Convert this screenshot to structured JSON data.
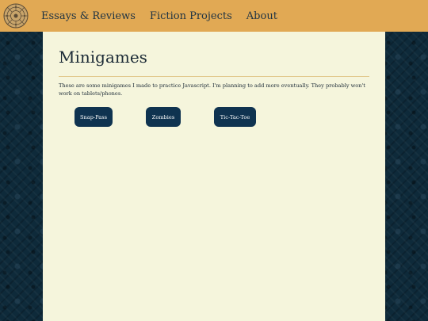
{
  "navbar": {
    "links": [
      {
        "label": "Essays & Reviews"
      },
      {
        "label": "Fiction Projects"
      },
      {
        "label": "About"
      }
    ]
  },
  "main": {
    "title": "Minigames",
    "intro": "These are some minigames I made to practice Javascript. I'm planning to add more eventually. They probably won't work on tablets/phones.",
    "games": [
      {
        "label": "Snap-Pass"
      },
      {
        "label": "Zombies"
      },
      {
        "label": "Tic-Tac-Toe"
      }
    ]
  },
  "colors": {
    "navbar": "#e1a954",
    "panel": "#f5f5dc",
    "button": "#0f3350",
    "background": "#0e2a3a"
  }
}
